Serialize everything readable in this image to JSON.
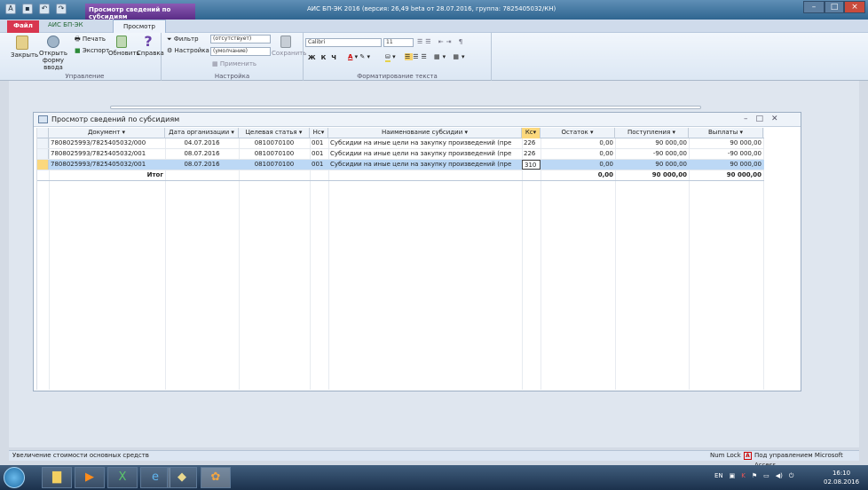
{
  "window": {
    "context_tab": "Просмотр сведений по субсидиям",
    "title": "АИС БП-ЭК 2016 (версия: 26,49 beta от 28.07.2016, группа: 7825405032/КН)"
  },
  "tabs": {
    "file": "Файл",
    "app": "АИС БП-ЭК",
    "view": "Просмотр"
  },
  "ribbon": {
    "manage": {
      "label": "Управление",
      "close": "Закрыть",
      "open": "Открыть форму ввода",
      "print": "Печать",
      "export": "Экспорт",
      "refresh": "Обновить",
      "help": "Справка"
    },
    "settings": {
      "label": "Настройка",
      "filter": "Фильтр",
      "filter_value": "(отсутствует)",
      "setting": "Настройка",
      "setting_value": "(умолчание)",
      "apply": "Применить",
      "save": "Сохранить"
    },
    "text": {
      "label": "Форматирование текста",
      "font": "Calibri",
      "size": "11"
    }
  },
  "subwin": {
    "title": "Просмотр сведений по субсидиям"
  },
  "table": {
    "headers": [
      "Документ",
      "Дата организации",
      "Целевая статья",
      "Нс",
      "Наименование субсидии",
      "Кс",
      "Остаток",
      "Поступления",
      "Выплаты"
    ],
    "rows": [
      {
        "doc": "7808025993/7825405032/000",
        "date": "04.07.2016",
        "art": "0810070100",
        "ns": "001",
        "name": "Субсидии на иные цели на закупку произведений (пре",
        "ks": "226",
        "rest": "0,00",
        "in": "90 000,00",
        "out": "90 000,00"
      },
      {
        "doc": "7808025993/7825405032/001",
        "date": "08.07.2016",
        "art": "0810070100",
        "ns": "001",
        "name": "Субсидии на иные цели на закупку произведений (пре",
        "ks": "226",
        "rest": "0,00",
        "in": "-90 000,00",
        "out": "-90 000,00"
      },
      {
        "doc": "7808025993/7825405032/001",
        "date": "08.07.2016",
        "art": "0810070100",
        "ns": "001",
        "name": "Субсидии на иные цели на закупку произведений (пре",
        "ks": "310",
        "rest": "0,00",
        "in": "90 000,00",
        "out": "90 000,00"
      }
    ],
    "total": {
      "label": "Итог",
      "rest": "0,00",
      "in": "90 000,00",
      "out": "90 000,00"
    }
  },
  "status": {
    "text": "Увеличение стоимости основных средств",
    "numlock": "Num Lock",
    "access": "Под управлением Microsoft Access"
  },
  "tray": {
    "lang": "EN",
    "time": "16:10",
    "date": "02.08.2016"
  }
}
